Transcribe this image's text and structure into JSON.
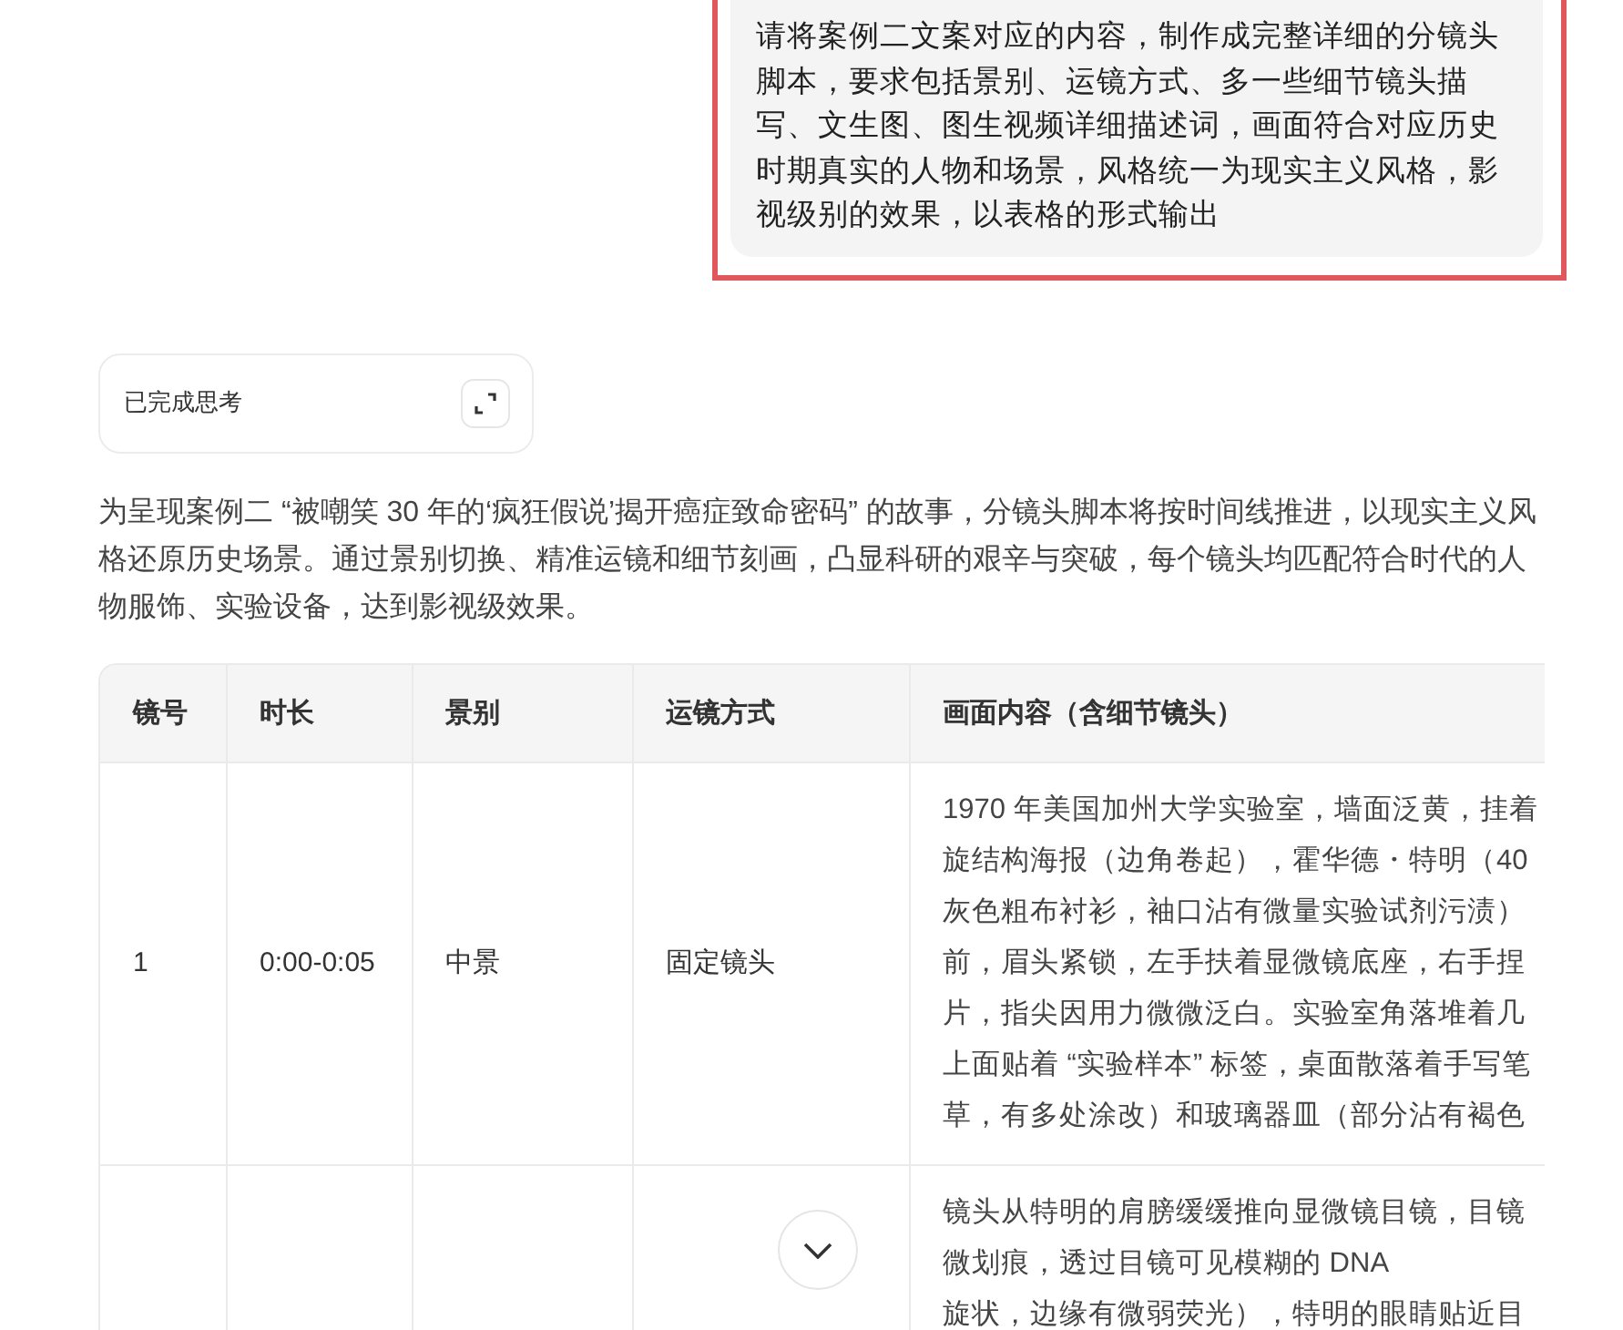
{
  "user_message": {
    "text": "请将案例二文案对应的内容，制作成完整详细的分镜头脚本，要求包括景别、运镜方式、多一些细节镜头描写、文生图、图生视频详细描述词，画面符合对应历史时期真实的人物和场景，风格统一为现实主义风格，影视级别的效果，以表格的形式输出",
    "highlighted": true
  },
  "thinking": {
    "label": "已完成思考",
    "expanded": false
  },
  "intro": "为呈现案例二 “被嘲笑 30 年的‘疯狂假说’揭开癌症致命密码” 的故事，分镜头脚本将按时间线推进，以现实主义风格还原历史场景。通过景别切换、精准运镜和细节刻画，凸显科研的艰辛与突破，每个镜头均匹配符合时代的人物服饰、实验设备，达到影视级效果。",
  "table": {
    "columns": [
      "镜号",
      "时长",
      "景别",
      "运镜方式",
      "画面内容（含细节镜头）"
    ],
    "rows": [
      {
        "cells": [
          "1",
          "0:00-0:05",
          "中景",
          "固定镜头"
        ],
        "content_lines": [
          "1970 年美国加州大学实验室，墙面泛黄，挂着",
          "旋结构海报（边角卷起），霍华德・特明（40",
          "灰色粗布衬衫，袖口沾有微量实验试剂污渍）",
          "前，眉头紧锁，左手扶着显微镜底座，右手捏",
          "片，指尖因用力微微泛白。实验室角落堆着几",
          "上面贴着 “实验样本” 标签，桌面散落着手写笔",
          "草，有多处涂改）和玻璃器皿（部分沾有褐色"
        ]
      },
      {
        "cells": [],
        "content_lines": [
          "镜头从特明的肩膀缓缓推向显微镜目镜，目镜",
          "微划痕，透过目镜可见模糊的 DNA",
          "旋状，边缘有微弱荧光），特明的眼睛贴近目"
        ]
      }
    ]
  }
}
